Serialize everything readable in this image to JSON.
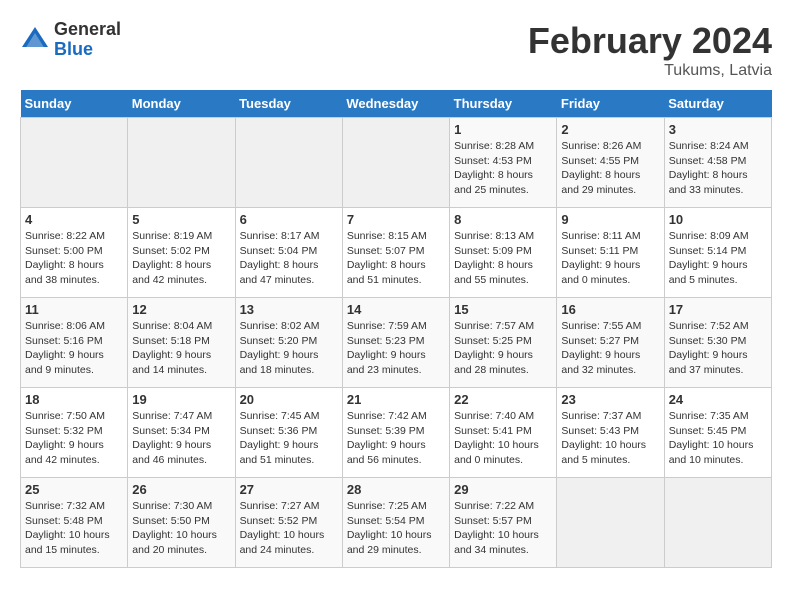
{
  "header": {
    "logo_general": "General",
    "logo_blue": "Blue",
    "title": "February 2024",
    "location": "Tukums, Latvia"
  },
  "weekdays": [
    "Sunday",
    "Monday",
    "Tuesday",
    "Wednesday",
    "Thursday",
    "Friday",
    "Saturday"
  ],
  "weeks": [
    [
      {
        "day": "",
        "info": ""
      },
      {
        "day": "",
        "info": ""
      },
      {
        "day": "",
        "info": ""
      },
      {
        "day": "",
        "info": ""
      },
      {
        "day": "1",
        "info": "Sunrise: 8:28 AM\nSunset: 4:53 PM\nDaylight: 8 hours\nand 25 minutes."
      },
      {
        "day": "2",
        "info": "Sunrise: 8:26 AM\nSunset: 4:55 PM\nDaylight: 8 hours\nand 29 minutes."
      },
      {
        "day": "3",
        "info": "Sunrise: 8:24 AM\nSunset: 4:58 PM\nDaylight: 8 hours\nand 33 minutes."
      }
    ],
    [
      {
        "day": "4",
        "info": "Sunrise: 8:22 AM\nSunset: 5:00 PM\nDaylight: 8 hours\nand 38 minutes."
      },
      {
        "day": "5",
        "info": "Sunrise: 8:19 AM\nSunset: 5:02 PM\nDaylight: 8 hours\nand 42 minutes."
      },
      {
        "day": "6",
        "info": "Sunrise: 8:17 AM\nSunset: 5:04 PM\nDaylight: 8 hours\nand 47 minutes."
      },
      {
        "day": "7",
        "info": "Sunrise: 8:15 AM\nSunset: 5:07 PM\nDaylight: 8 hours\nand 51 minutes."
      },
      {
        "day": "8",
        "info": "Sunrise: 8:13 AM\nSunset: 5:09 PM\nDaylight: 8 hours\nand 55 minutes."
      },
      {
        "day": "9",
        "info": "Sunrise: 8:11 AM\nSunset: 5:11 PM\nDaylight: 9 hours\nand 0 minutes."
      },
      {
        "day": "10",
        "info": "Sunrise: 8:09 AM\nSunset: 5:14 PM\nDaylight: 9 hours\nand 5 minutes."
      }
    ],
    [
      {
        "day": "11",
        "info": "Sunrise: 8:06 AM\nSunset: 5:16 PM\nDaylight: 9 hours\nand 9 minutes."
      },
      {
        "day": "12",
        "info": "Sunrise: 8:04 AM\nSunset: 5:18 PM\nDaylight: 9 hours\nand 14 minutes."
      },
      {
        "day": "13",
        "info": "Sunrise: 8:02 AM\nSunset: 5:20 PM\nDaylight: 9 hours\nand 18 minutes."
      },
      {
        "day": "14",
        "info": "Sunrise: 7:59 AM\nSunset: 5:23 PM\nDaylight: 9 hours\nand 23 minutes."
      },
      {
        "day": "15",
        "info": "Sunrise: 7:57 AM\nSunset: 5:25 PM\nDaylight: 9 hours\nand 28 minutes."
      },
      {
        "day": "16",
        "info": "Sunrise: 7:55 AM\nSunset: 5:27 PM\nDaylight: 9 hours\nand 32 minutes."
      },
      {
        "day": "17",
        "info": "Sunrise: 7:52 AM\nSunset: 5:30 PM\nDaylight: 9 hours\nand 37 minutes."
      }
    ],
    [
      {
        "day": "18",
        "info": "Sunrise: 7:50 AM\nSunset: 5:32 PM\nDaylight: 9 hours\nand 42 minutes."
      },
      {
        "day": "19",
        "info": "Sunrise: 7:47 AM\nSunset: 5:34 PM\nDaylight: 9 hours\nand 46 minutes."
      },
      {
        "day": "20",
        "info": "Sunrise: 7:45 AM\nSunset: 5:36 PM\nDaylight: 9 hours\nand 51 minutes."
      },
      {
        "day": "21",
        "info": "Sunrise: 7:42 AM\nSunset: 5:39 PM\nDaylight: 9 hours\nand 56 minutes."
      },
      {
        "day": "22",
        "info": "Sunrise: 7:40 AM\nSunset: 5:41 PM\nDaylight: 10 hours\nand 0 minutes."
      },
      {
        "day": "23",
        "info": "Sunrise: 7:37 AM\nSunset: 5:43 PM\nDaylight: 10 hours\nand 5 minutes."
      },
      {
        "day": "24",
        "info": "Sunrise: 7:35 AM\nSunset: 5:45 PM\nDaylight: 10 hours\nand 10 minutes."
      }
    ],
    [
      {
        "day": "25",
        "info": "Sunrise: 7:32 AM\nSunset: 5:48 PM\nDaylight: 10 hours\nand 15 minutes."
      },
      {
        "day": "26",
        "info": "Sunrise: 7:30 AM\nSunset: 5:50 PM\nDaylight: 10 hours\nand 20 minutes."
      },
      {
        "day": "27",
        "info": "Sunrise: 7:27 AM\nSunset: 5:52 PM\nDaylight: 10 hours\nand 24 minutes."
      },
      {
        "day": "28",
        "info": "Sunrise: 7:25 AM\nSunset: 5:54 PM\nDaylight: 10 hours\nand 29 minutes."
      },
      {
        "day": "29",
        "info": "Sunrise: 7:22 AM\nSunset: 5:57 PM\nDaylight: 10 hours\nand 34 minutes."
      },
      {
        "day": "",
        "info": ""
      },
      {
        "day": "",
        "info": ""
      }
    ]
  ]
}
